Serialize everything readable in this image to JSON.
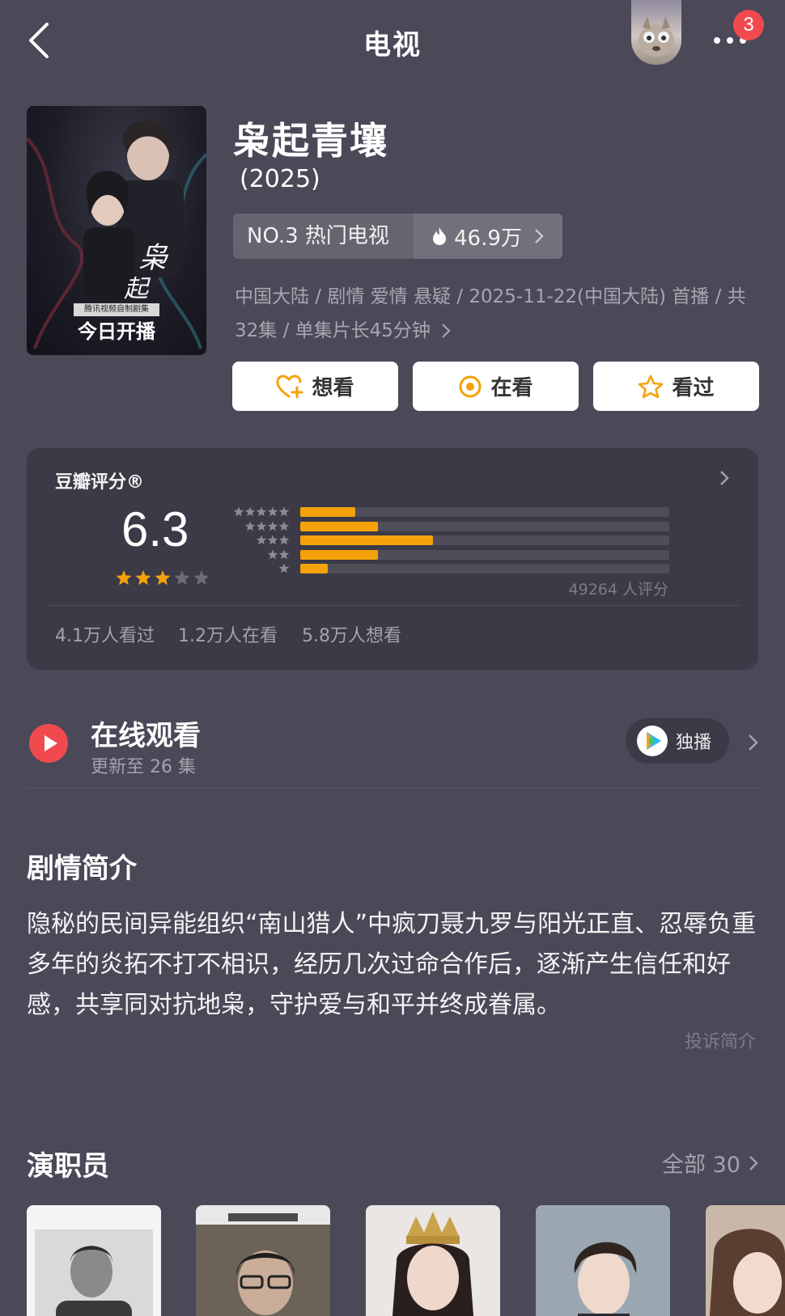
{
  "header": {
    "title": "电视",
    "notification_count": "3"
  },
  "poster": {
    "caption": "今日开播",
    "ribbon": "腾讯视频自制剧集"
  },
  "show": {
    "title": "枭起青壤",
    "year": "(2025)",
    "rank_label": "NO.3 热门电视",
    "heat": "46.9万",
    "meta": "中国大陆 / 剧情 爱情 悬疑 / 2025-11-22(中国大陆) 首播 / 共32集 / 单集片长45分钟"
  },
  "actions": [
    {
      "label": "想看",
      "icon": "heart-plus-icon"
    },
    {
      "label": "在看",
      "icon": "watching-icon"
    },
    {
      "label": "看过",
      "icon": "star-outline-icon"
    }
  ],
  "rating": {
    "brand": "豆瓣评分®",
    "score": "6.3",
    "stars": 3,
    "distribution": [
      {
        "stars": 5,
        "fraction": 0.15
      },
      {
        "stars": 4,
        "fraction": 0.21
      },
      {
        "stars": 3,
        "fraction": 0.36
      },
      {
        "stars": 2,
        "fraction": 0.21
      },
      {
        "stars": 1,
        "fraction": 0.075
      }
    ],
    "count": "49264 人评分",
    "stats": [
      "4.1万人看过",
      "1.2万人在看",
      "5.8万人想看"
    ]
  },
  "watch": {
    "title": "在线观看",
    "subtitle": "更新至 26 集",
    "platform_label": "独播",
    "platform_icon": "tencent-video-icon"
  },
  "synopsis": {
    "heading": "剧情简介",
    "text": "隐秘的民间异能组织“南山猎人”中疯刀聂九罗与阳光正直、忍辱负重多年的炎拓不打不相识，经历几次过命合作后，逐渐产生信任和好感，共享同对抗地枭，守护爱与和平并终成眷属。",
    "report_label": "投诉简介"
  },
  "cast": {
    "heading": "演职员",
    "all_label": "全部 30"
  },
  "colors": {
    "background": "#4b4858",
    "card": "#3b3a46",
    "accent": "#f5a20a",
    "badge": "#f04a4f"
  }
}
